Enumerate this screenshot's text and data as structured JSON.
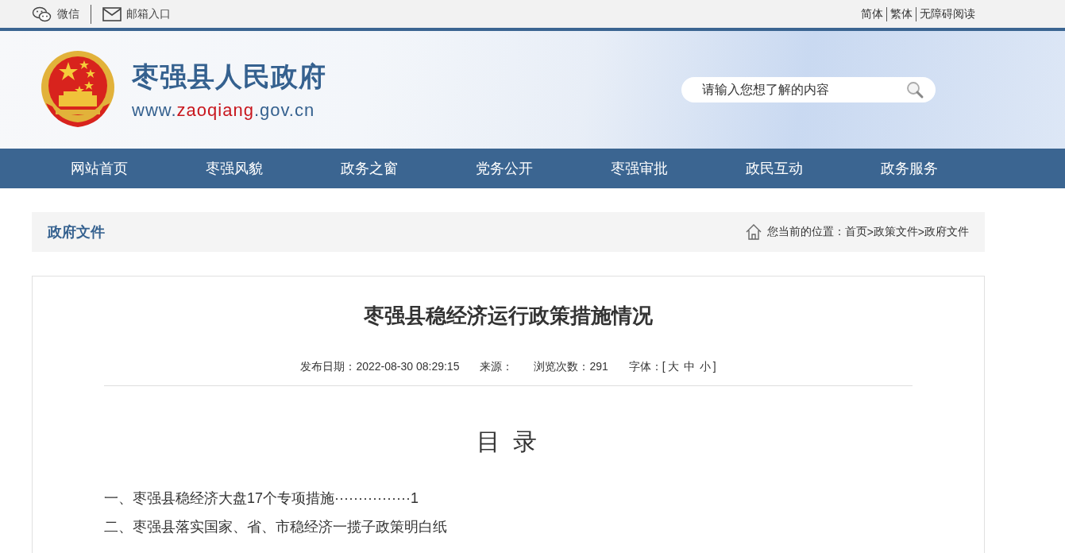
{
  "top_bar": {
    "left_links": [
      {
        "kind": "wechat",
        "label": "微信"
      },
      {
        "kind": "mail",
        "label": "邮箱入口"
      }
    ],
    "right_links": [
      "简体",
      "繁体",
      "无障碍阅读"
    ]
  },
  "header": {
    "site_title": "枣强县人民政府",
    "url_parts": [
      {
        "text": "www.",
        "accent": false
      },
      {
        "text": "zaoqiang",
        "accent": true
      },
      {
        "text": ".gov.cn",
        "accent": false
      }
    ],
    "search": {
      "placeholder": "请输入您想了解的内容"
    }
  },
  "nav": {
    "items": [
      {
        "label": "网站首页",
        "selected": false
      },
      {
        "label": "枣强风貌",
        "selected": false
      },
      {
        "label": "政务之窗",
        "selected": false
      },
      {
        "label": "党务公开",
        "selected": false
      },
      {
        "label": "枣强审批",
        "selected": false
      },
      {
        "label": "政民互动",
        "selected": false
      },
      {
        "label": "政务服务",
        "selected": false
      }
    ]
  },
  "section_bar": {
    "title": "政府文件",
    "location_label": "您当前的位置：",
    "breadcrumb": [
      "首页",
      "政策文件",
      "政府文件"
    ],
    "separator": ">"
  },
  "article": {
    "title": "枣强县稳经济运行政策措施情况",
    "meta": [
      {
        "label": "发布日期：",
        "value": "2022-08-30  08:29:15"
      },
      {
        "label": "来源："
      },
      {
        "label": "浏览次数：",
        "value": "291"
      }
    ],
    "font_size": {
      "label": "字体：",
      "open": "[",
      "options": [
        "大",
        "中",
        "小"
      ],
      "close": "]"
    },
    "toc_heading": "目 录",
    "toc": [
      "一、枣强县稳经济大盘17个专项措施················1",
      "二、枣强县落实国家、省、市稳经济一揽子政策明白纸"
    ]
  }
}
